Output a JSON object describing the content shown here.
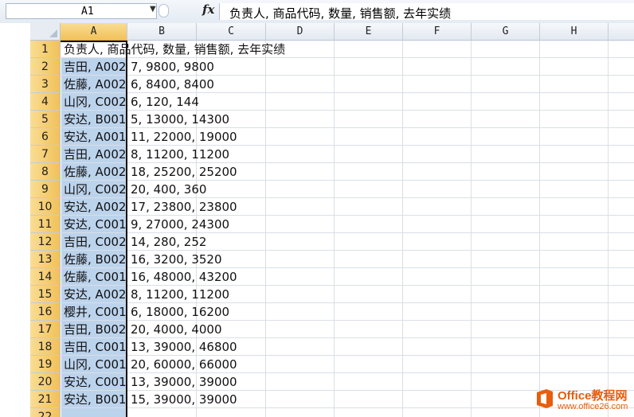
{
  "formula_bar": {
    "name_box": "A1",
    "fx_label": "fx",
    "formula": "负责人, 商品代码, 数量, 销售额, 去年实绩"
  },
  "columns": [
    "A",
    "B",
    "C",
    "D",
    "E",
    "F",
    "G",
    "H"
  ],
  "selected_column": "A",
  "active_cell": "A1",
  "rows": [
    {
      "num": "1",
      "a": "负责人, 商品代码, 数量, 销售额, 去年实绩",
      "b": ""
    },
    {
      "num": "2",
      "a": "吉田, A002",
      "b": "7, 9800, 9800"
    },
    {
      "num": "3",
      "a": "佐藤, A002",
      "b": "6, 8400, 8400"
    },
    {
      "num": "4",
      "a": "山冈, C002",
      "b": "6, 120, 144"
    },
    {
      "num": "5",
      "a": "安达, B001",
      "b": "5, 13000, 14300"
    },
    {
      "num": "6",
      "a": "安达, A001",
      "b": "11, 22000, 19000"
    },
    {
      "num": "7",
      "a": "吉田, A002",
      "b": "8, 11200, 11200"
    },
    {
      "num": "8",
      "a": "佐藤, A002",
      "b": "18, 25200, 25200"
    },
    {
      "num": "9",
      "a": "山冈, C002",
      "b": "20, 400, 360"
    },
    {
      "num": "10",
      "a": "安达, A002",
      "b": "17, 23800, 23800"
    },
    {
      "num": "11",
      "a": "安达, C001",
      "b": "9, 27000, 24300"
    },
    {
      "num": "12",
      "a": "吉田, C002",
      "b": "14, 280, 252"
    },
    {
      "num": "13",
      "a": "佐藤, B002",
      "b": "16, 3200, 3520"
    },
    {
      "num": "14",
      "a": "佐藤, C001",
      "b": "16, 48000, 43200"
    },
    {
      "num": "15",
      "a": "安达, A002",
      "b": "8, 11200, 11200"
    },
    {
      "num": "16",
      "a": "樱井, C001",
      "b": "6, 18000, 16200"
    },
    {
      "num": "17",
      "a": "吉田, B002",
      "b": "20, 4000, 4000"
    },
    {
      "num": "18",
      "a": "吉田, C001",
      "b": "13, 39000, 46800"
    },
    {
      "num": "19",
      "a": "山冈, C001",
      "b": "20, 60000, 66000"
    },
    {
      "num": "20",
      "a": "安达, C001",
      "b": "13, 39000, 39000"
    },
    {
      "num": "21",
      "a": "安达, B001",
      "b": "15, 39000, 39000"
    },
    {
      "num": "22",
      "a": "",
      "b": ""
    }
  ],
  "watermark": {
    "title": "Office教程网",
    "url": "www.office26.com"
  },
  "colors": {
    "selection_fill": "#bcd3ec",
    "header_highlight": "#f1c15a",
    "watermark": "#e85d0c"
  }
}
